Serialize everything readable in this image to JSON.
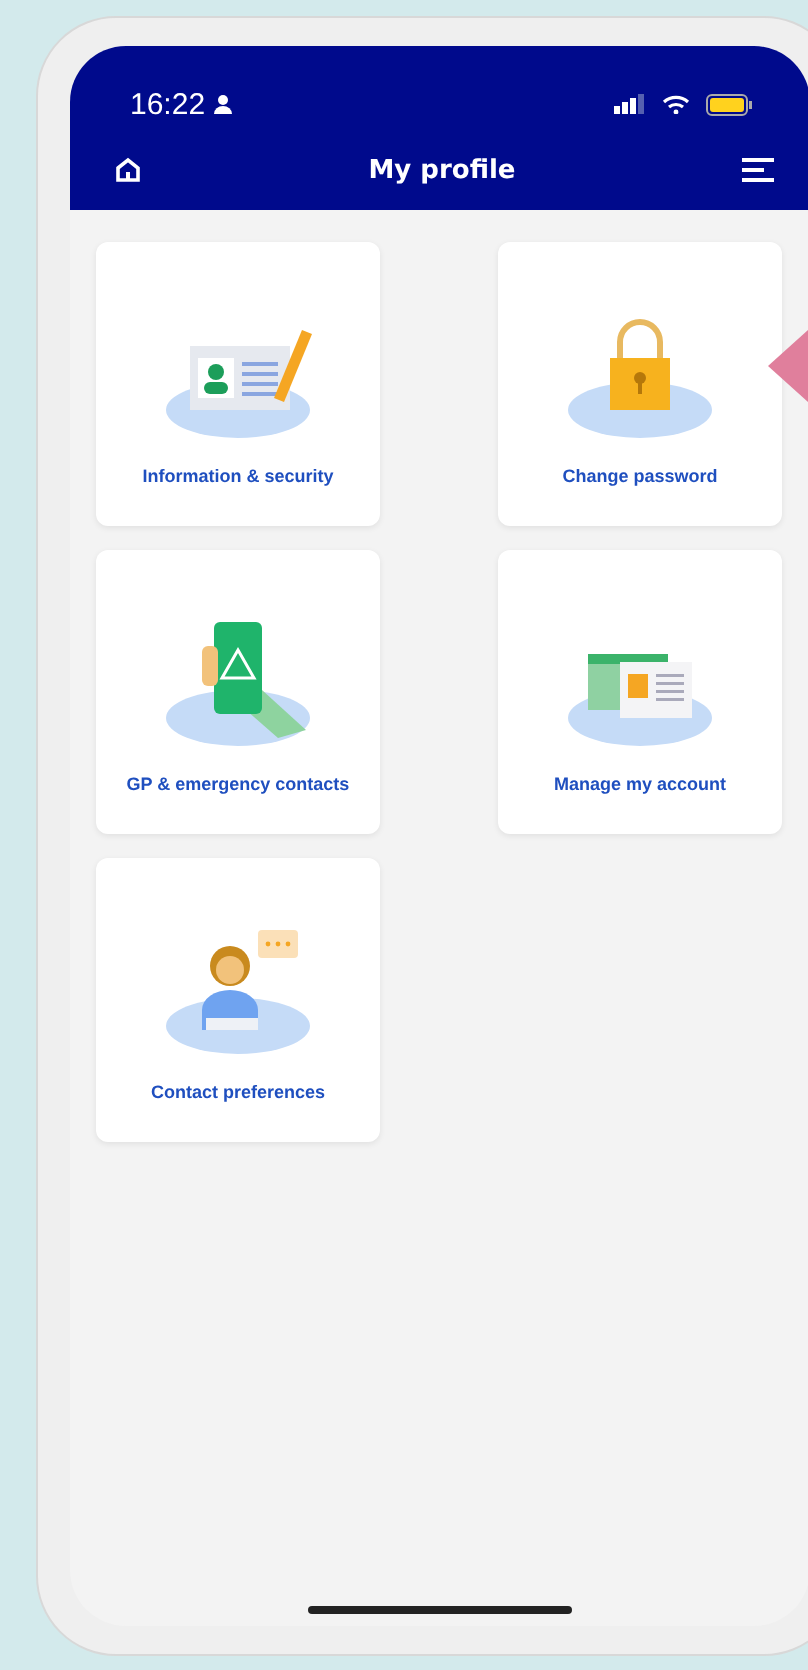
{
  "status_bar": {
    "time": "16:22"
  },
  "header": {
    "title": "My profile"
  },
  "tiles": [
    {
      "kind": "identity",
      "label": "Information & security"
    },
    {
      "kind": "lock",
      "label": "Change password"
    },
    {
      "kind": "emergency",
      "label": "GP & emergency contacts"
    },
    {
      "kind": "account",
      "label": "Manage my account"
    },
    {
      "kind": "contact",
      "label": "Contact preferences"
    }
  ]
}
